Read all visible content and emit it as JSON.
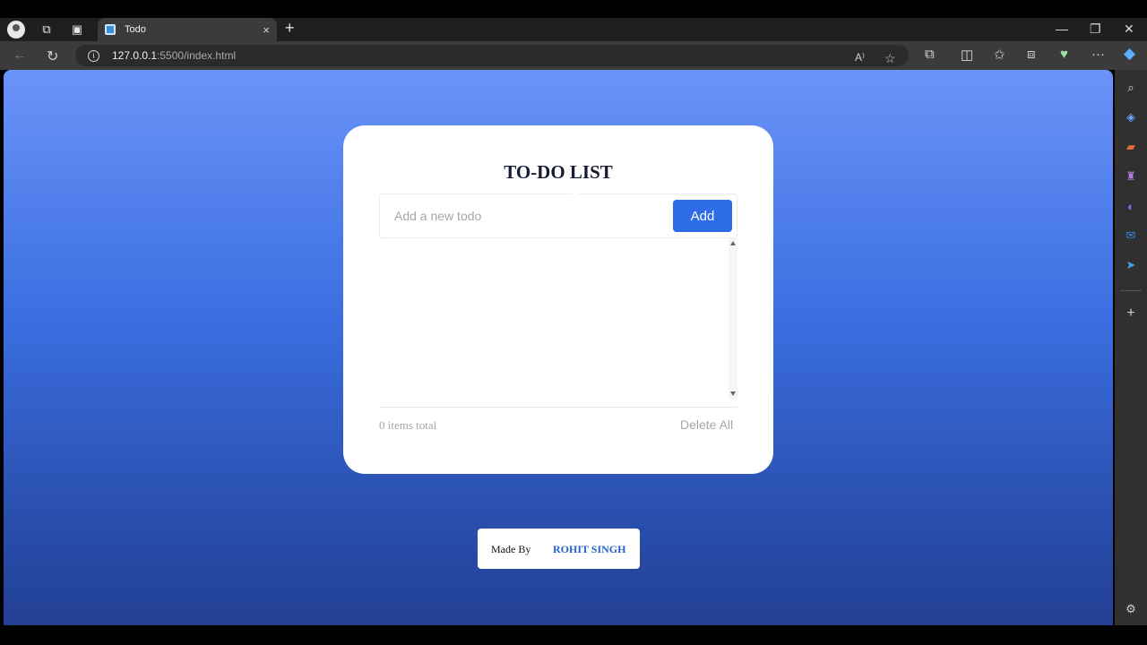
{
  "browser": {
    "tab_title": "Todo",
    "close_glyph": "×",
    "new_tab_glyph": "+",
    "url_host": "127.0.0.1",
    "url_path": ":5500/index.html",
    "back_glyph": "←",
    "reload_glyph": "↻",
    "minimize_glyph": "—",
    "restore_glyph": "❐",
    "window_close_glyph": "✕",
    "more_glyph": "···"
  },
  "app": {
    "title": "TO-DO LIST",
    "input_placeholder": "Add a new todo",
    "input_value": "",
    "add_label": "Add",
    "items_total": "0 items total",
    "delete_all_label": "Delete All",
    "todos": []
  },
  "footer": {
    "made_by": "Made By",
    "author": "ROHIT SINGH"
  },
  "colors": {
    "accent": "#2f6de8",
    "author": "#2563c9",
    "bg_top": "#6a93f8",
    "bg_bottom": "#223f94"
  }
}
